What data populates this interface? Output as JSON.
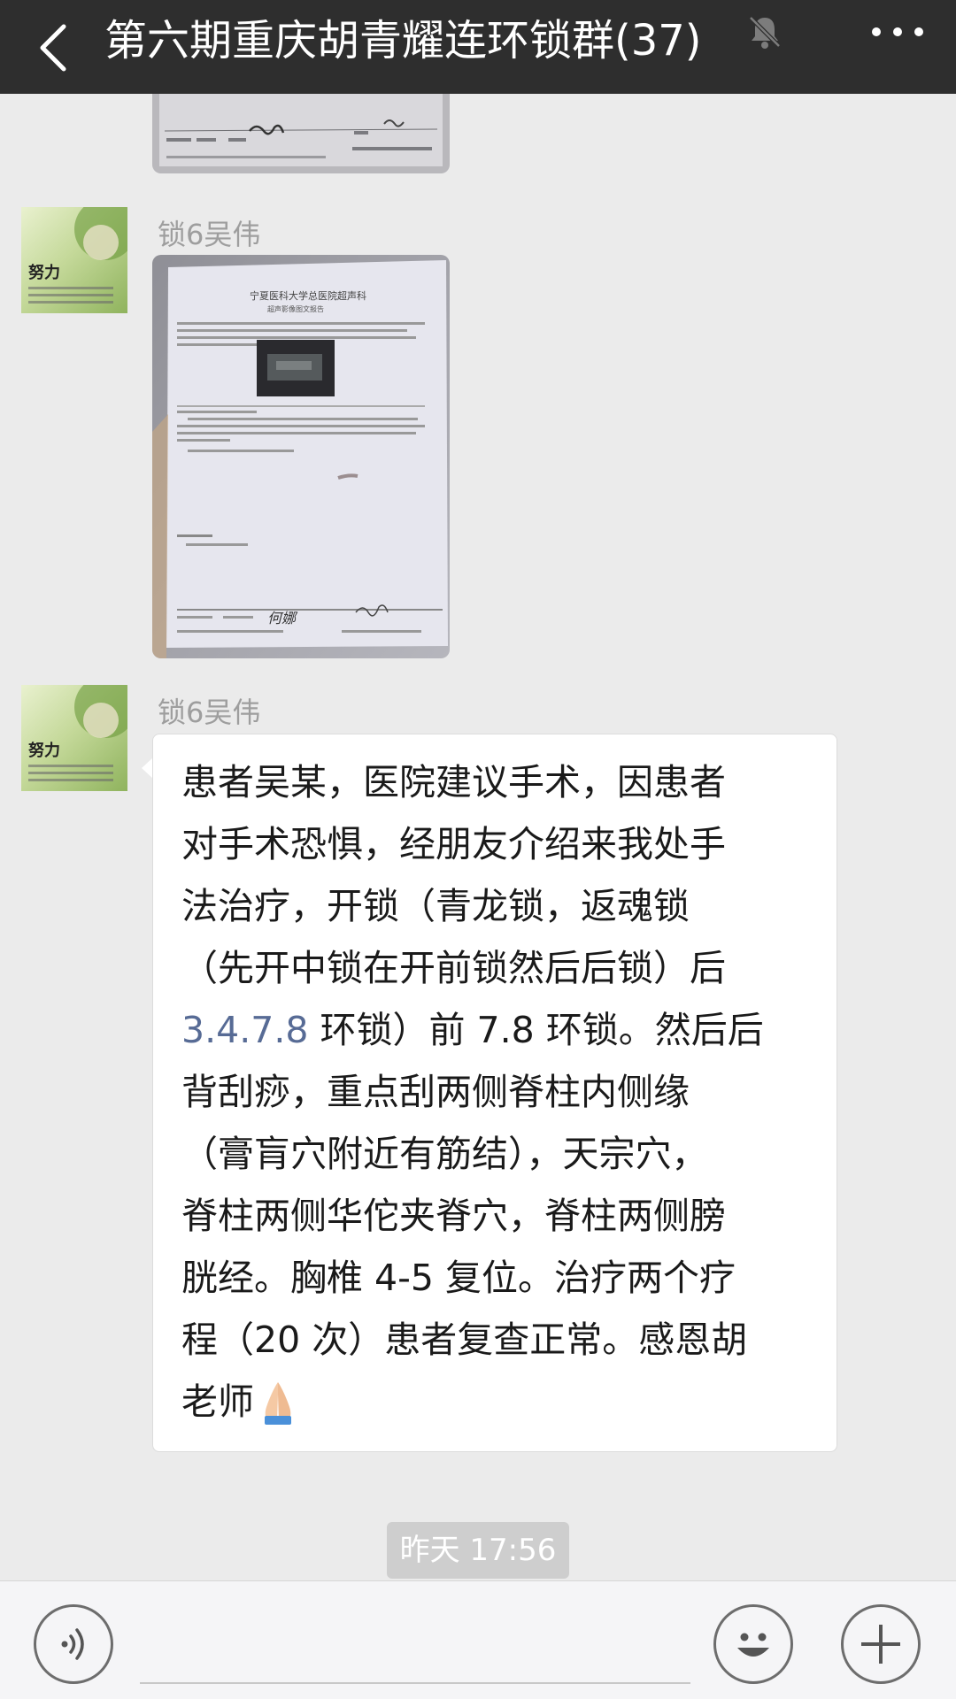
{
  "header": {
    "title": "第六期重庆胡青耀连环锁群(37)"
  },
  "messages": [
    {
      "type": "image",
      "content": "medical-report-photo"
    },
    {
      "sender": "锁6吴伟",
      "type": "image",
      "content": "ultrasound-report-photo",
      "doc_title": "宁夏医科大学总医院超声科",
      "doc_subtitle": "超声影像图文报告",
      "doc_signature": "何娜"
    },
    {
      "sender": "锁6吴伟",
      "type": "text",
      "lines": [
        "患者吴某，医院建议手术，因患者",
        "对手术恐惧，经朋友介绍来我处手",
        "法治疗，开锁（青龙锁，返魂锁",
        "（先开中锁在开前锁然后后锁）后",
        "3.4.7.8",
        " 环锁）前 7.8 环锁。然后后",
        "背刮痧，重点刮两侧脊柱内侧缘",
        "（膏肓穴附近有筋结），天宗穴，",
        "脊柱两侧华佗夹脊穴，脊柱两侧膀",
        "胱经。胸椎 4-5 复位。治疗两个疗",
        "程（20 次）患者复查正常。感恩胡",
        "老师"
      ],
      "emoji": "folded-hands-icon"
    }
  ],
  "timestamp": "昨天 17:56",
  "avatar_text": "努力",
  "colors": {
    "topbar": "#2e2e2e",
    "background": "#ebebeb",
    "link": "#576b95",
    "bubble": "#ffffff"
  }
}
